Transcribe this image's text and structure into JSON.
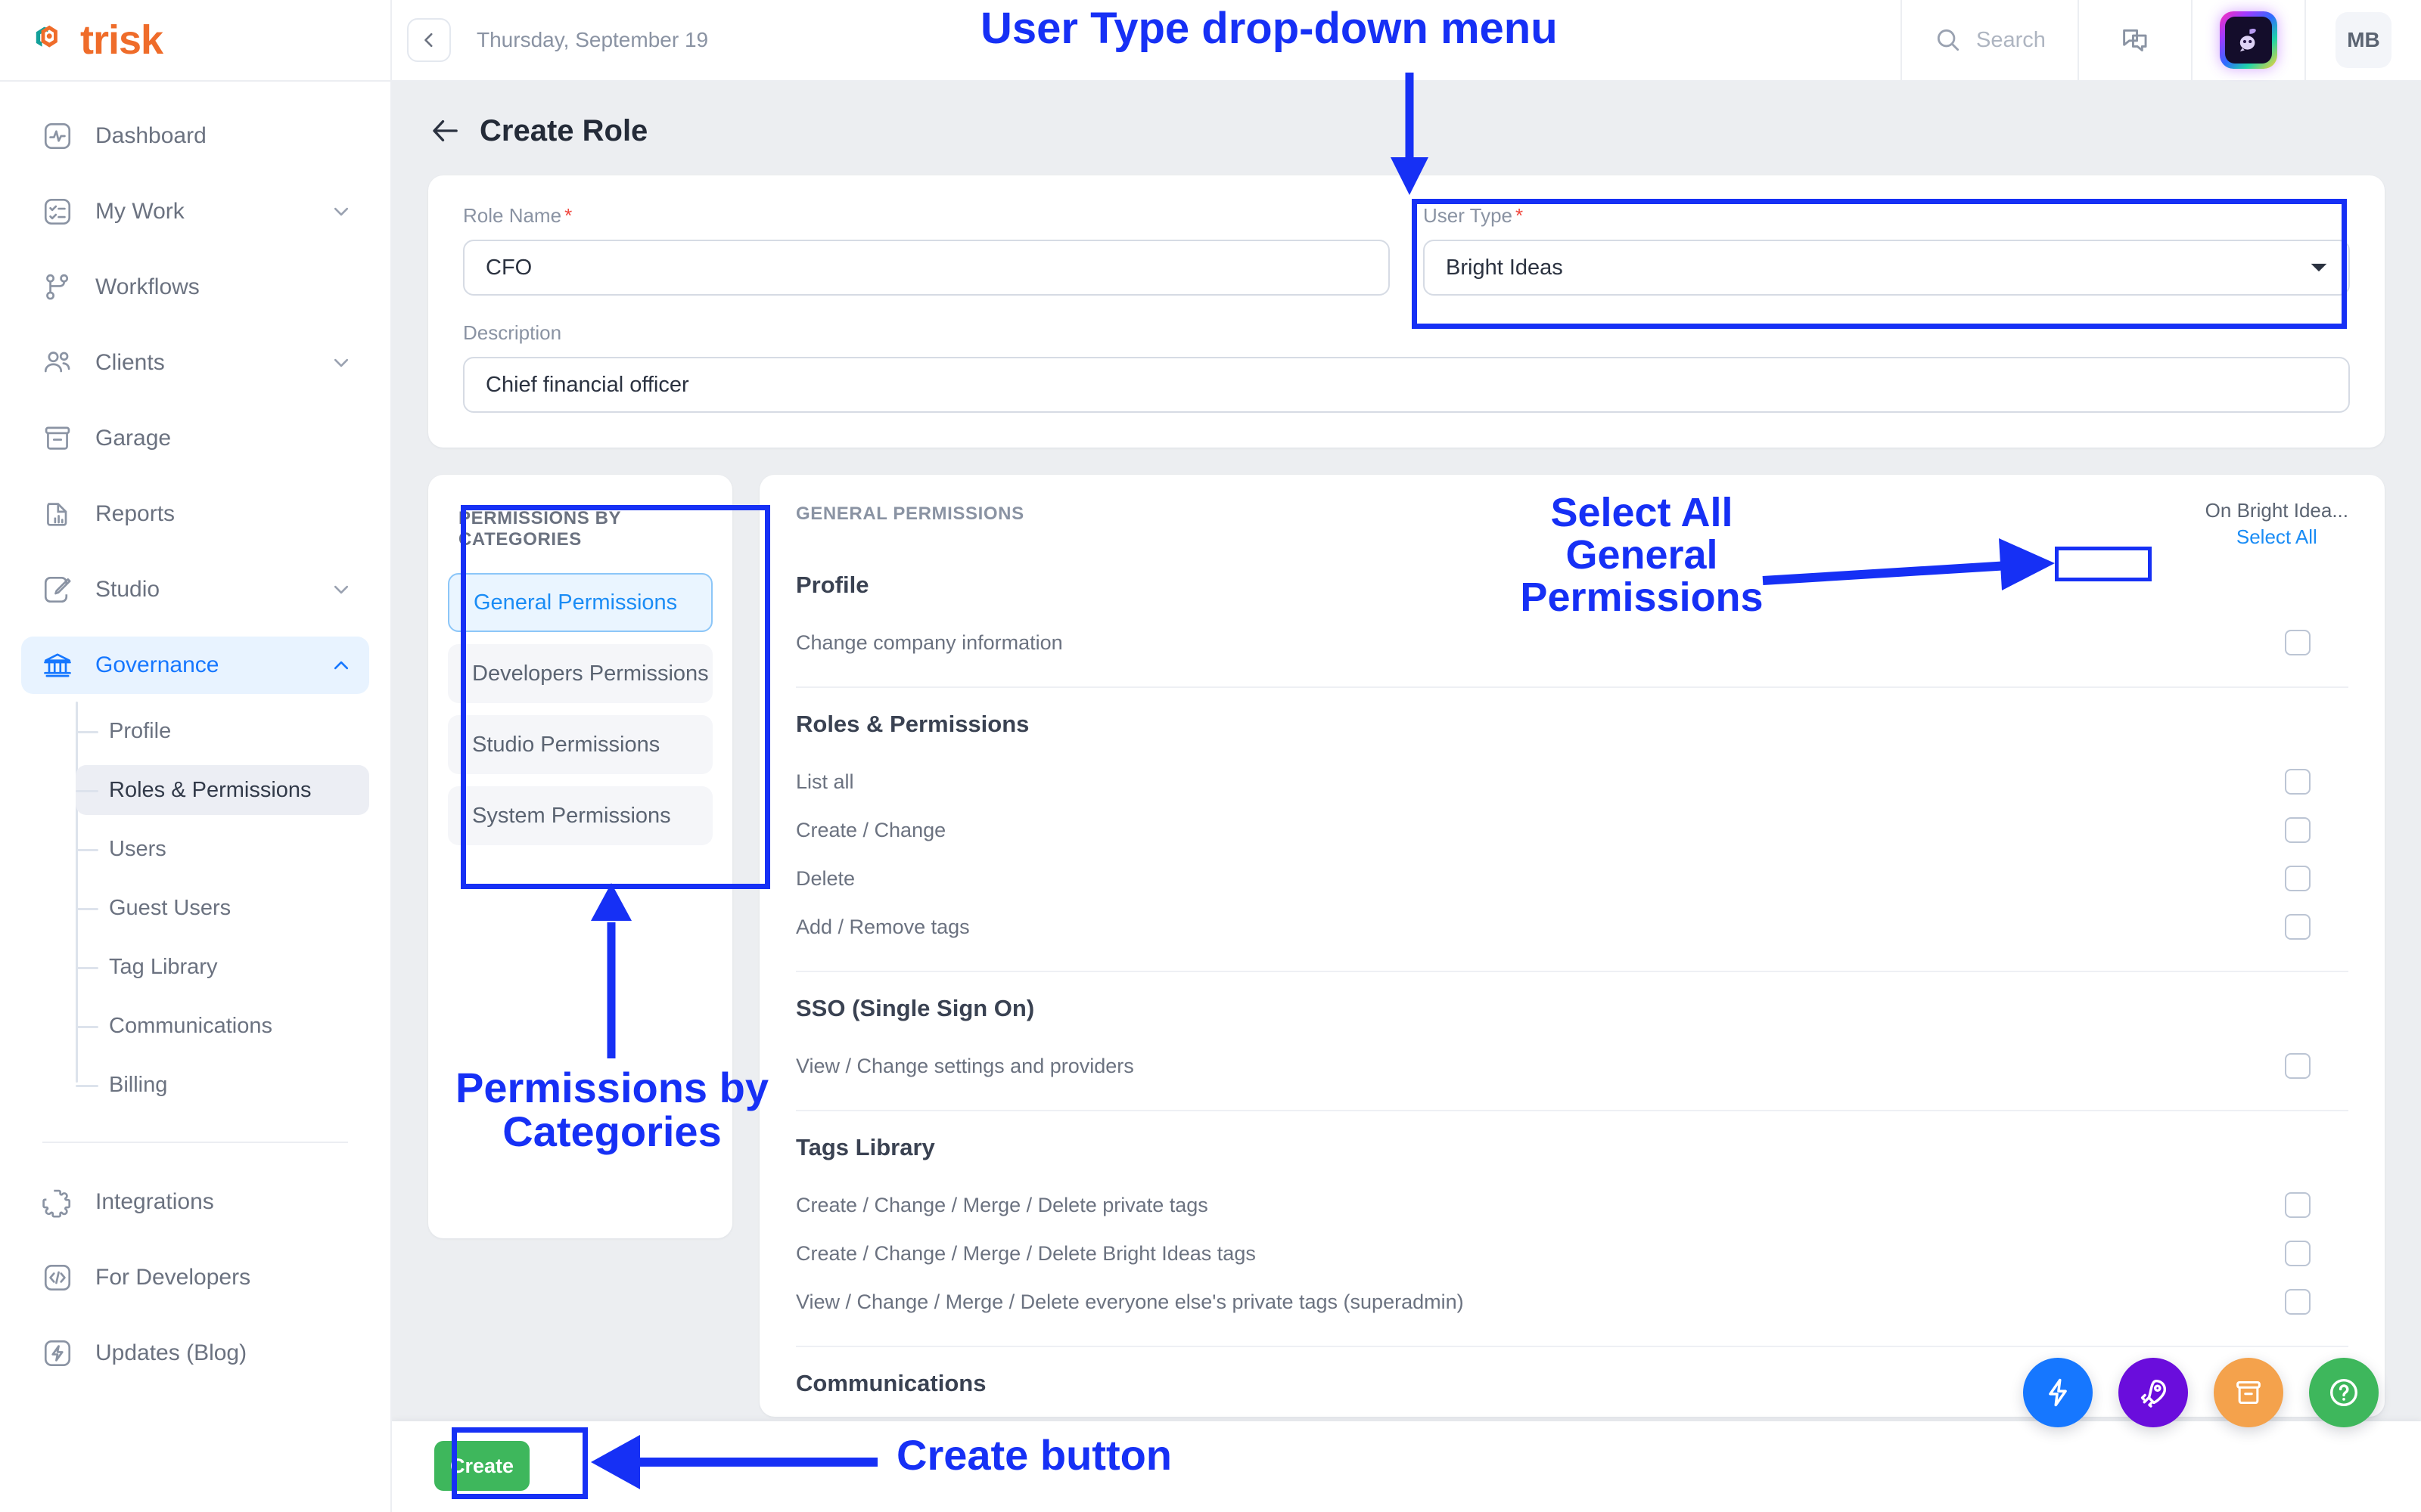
{
  "brand": {
    "name": "trisk",
    "logo_icon": "trisk-hexagon-logo",
    "accent_orange": "#ef6c2a",
    "accent_teal": "#13a09a"
  },
  "topbar": {
    "collapse_icon": "chevron-left-icon",
    "date": "Thursday, September 19",
    "search_label": "Search",
    "search_icon": "search-icon",
    "chat_icon": "chat-bubbles-icon",
    "ai_assistant_icon": "ai-assistant-icon",
    "avatar_initials": "MB"
  },
  "sidebar": {
    "items": [
      {
        "label": "Dashboard",
        "icon": "dashboard-pulse-icon",
        "expandable": false,
        "active": false
      },
      {
        "label": "My Work",
        "icon": "checklist-icon",
        "expandable": true,
        "active": false
      },
      {
        "label": "Workflows",
        "icon": "workflow-branch-icon",
        "expandable": false,
        "active": false
      },
      {
        "label": "Clients",
        "icon": "users-icon",
        "expandable": true,
        "active": false
      },
      {
        "label": "Garage",
        "icon": "archive-box-icon",
        "expandable": false,
        "active": false
      },
      {
        "label": "Reports",
        "icon": "report-document-icon",
        "expandable": false,
        "active": false
      },
      {
        "label": "Studio",
        "icon": "brush-icon",
        "expandable": true,
        "active": false
      },
      {
        "label": "Governance",
        "icon": "bank-columns-icon",
        "expandable": true,
        "active": true
      }
    ],
    "governance_subitems": [
      {
        "label": "Profile",
        "active": false
      },
      {
        "label": "Roles & Permissions",
        "active": true
      },
      {
        "label": "Users",
        "active": false
      },
      {
        "label": "Guest Users",
        "active": false
      },
      {
        "label": "Tag Library",
        "active": false
      },
      {
        "label": "Communications",
        "active": false
      },
      {
        "label": "Billing",
        "active": false
      }
    ],
    "bottom_items": [
      {
        "label": "Integrations",
        "icon": "puzzle-piece-icon"
      },
      {
        "label": "For Developers",
        "icon": "code-brackets-icon"
      },
      {
        "label": "Updates (Blog)",
        "icon": "lightning-bolt-icon"
      }
    ]
  },
  "page": {
    "title": "Create Role",
    "back_icon": "arrow-left-icon"
  },
  "form": {
    "role_name": {
      "label": "Role Name",
      "required_mark": "*",
      "value": "CFO"
    },
    "user_type": {
      "label": "User Type",
      "required_mark": "*",
      "value": "Bright Ideas",
      "caret_icon": "chevron-down-icon"
    },
    "description": {
      "label": "Description",
      "value": "Chief financial officer"
    }
  },
  "categories_panel": {
    "title": "PERMISSIONS BY CATEGORIES",
    "items": [
      {
        "label": "General Permissions",
        "selected": true
      },
      {
        "label": "Developers Permissions",
        "selected": false
      },
      {
        "label": "Studio Permissions",
        "selected": false
      },
      {
        "label": "System Permissions",
        "selected": false
      }
    ]
  },
  "permissions_panel": {
    "header_title": "GENERAL PERMISSIONS",
    "on_label": "On Bright Idea...",
    "select_all_label": "Select All",
    "groups": [
      {
        "title": "Profile",
        "rows": [
          {
            "label": "Change company information",
            "checked": false
          }
        ]
      },
      {
        "title": "Roles & Permissions",
        "rows": [
          {
            "label": "List all",
            "checked": false
          },
          {
            "label": "Create / Change",
            "checked": false
          },
          {
            "label": "Delete",
            "checked": false
          },
          {
            "label": "Add / Remove tags",
            "checked": false
          }
        ]
      },
      {
        "title": "SSO (Single Sign On)",
        "rows": [
          {
            "label": "View / Change settings and providers",
            "checked": false
          }
        ]
      },
      {
        "title": "Tags Library",
        "rows": [
          {
            "label": "Create / Change / Merge / Delete private tags",
            "checked": false
          },
          {
            "label": "Create / Change / Merge / Delete Bright Ideas tags",
            "checked": false
          },
          {
            "label": "View / Change / Merge / Delete everyone else's private tags (superadmin)",
            "checked": false
          }
        ]
      },
      {
        "title": "Communications",
        "rows": []
      }
    ]
  },
  "footer": {
    "create_label": "Create"
  },
  "fabs": [
    {
      "icon": "lightning-bolt-icon",
      "color": "#1677ff"
    },
    {
      "icon": "rocket-icon",
      "color": "#6a0ddc"
    },
    {
      "icon": "archive-box-icon",
      "color": "#f4a24c"
    },
    {
      "icon": "help-question-icon",
      "color": "#3eb75c"
    }
  ],
  "annotations": {
    "color": "#1630f5",
    "user_type": "User Type drop-down menu",
    "select_all": "Select All\nGeneral\nPermissions",
    "categories": "Permissions by\nCategories",
    "create_button": "Create button"
  }
}
